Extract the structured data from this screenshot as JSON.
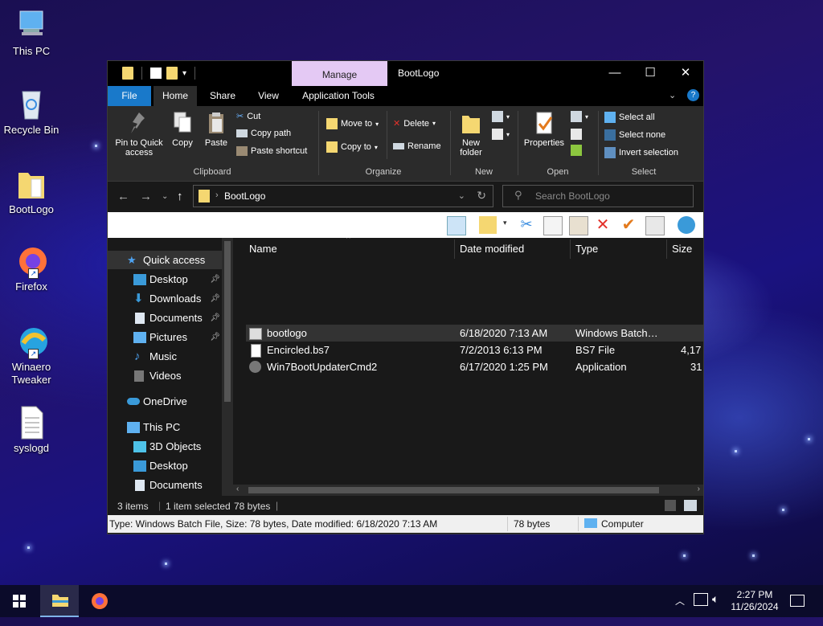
{
  "desktop": {
    "icons": [
      {
        "label": "This PC",
        "icon": "computer-icon"
      },
      {
        "label": "Recycle Bin",
        "icon": "recycle-bin-icon"
      },
      {
        "label": "BootLogo",
        "icon": "folder-icon"
      },
      {
        "label": "Firefox",
        "icon": "firefox-icon"
      },
      {
        "label": "Winaero\nTweaker",
        "icon": "winaero-tweaker-icon"
      },
      {
        "label": "syslogd",
        "icon": "text-file-icon"
      }
    ]
  },
  "window": {
    "title": "BootLogo",
    "context_tab": "Manage",
    "tabs": [
      "File",
      "Home",
      "Share",
      "View",
      "Application Tools"
    ],
    "ribbon": {
      "clipboard": {
        "label": "Clipboard",
        "pin": "Pin to Quick\naccess",
        "copy": "Copy",
        "paste": "Paste",
        "cut": "Cut",
        "copy_path": "Copy path",
        "paste_shortcut": "Paste shortcut"
      },
      "organize": {
        "label": "Organize",
        "move_to": "Move to",
        "copy_to": "Copy to",
        "delete": "Delete",
        "rename": "Rename"
      },
      "new": {
        "label": "New",
        "new_folder": "New\nfolder"
      },
      "open": {
        "label": "Open",
        "properties": "Properties"
      },
      "select": {
        "label": "Select",
        "select_all": "Select all",
        "select_none": "Select none",
        "invert": "Invert selection"
      }
    },
    "address": {
      "path": "BootLogo",
      "search_placeholder": "Search BootLogo"
    },
    "nav": {
      "items": [
        {
          "label": "Quick access",
          "icon": "star-icon",
          "pinned": false,
          "selected": true
        },
        {
          "label": "Desktop",
          "icon": "desktop-icon",
          "pinned": true
        },
        {
          "label": "Downloads",
          "icon": "download-icon",
          "pinned": true
        },
        {
          "label": "Documents",
          "icon": "documents-icon",
          "pinned": true
        },
        {
          "label": "Pictures",
          "icon": "pictures-icon",
          "pinned": true
        },
        {
          "label": "Music",
          "icon": "music-icon",
          "pinned": false
        },
        {
          "label": "Videos",
          "icon": "videos-icon",
          "pinned": false
        },
        {
          "label": "OneDrive",
          "icon": "onedrive-icon",
          "pinned": false
        },
        {
          "label": "This PC",
          "icon": "computer-icon",
          "pinned": false
        },
        {
          "label": "3D Objects",
          "icon": "cube-icon",
          "pinned": false
        },
        {
          "label": "Desktop",
          "icon": "desktop-icon",
          "pinned": false
        },
        {
          "label": "Documents",
          "icon": "documents-icon",
          "pinned": false
        }
      ]
    },
    "columns": {
      "name": "Name",
      "date": "Date modified",
      "type": "Type",
      "size": "Size"
    },
    "files": [
      {
        "name": "bootlogo",
        "date": "6/18/2020 7:13 AM",
        "type": "Windows Batch…",
        "size": "",
        "icon": "batch-file-icon",
        "selected": true
      },
      {
        "name": "Encircled.bs7",
        "date": "7/2/2013 6:13 PM",
        "type": "BS7 File",
        "size": "4,17",
        "icon": "file-icon",
        "selected": false
      },
      {
        "name": "Win7BootUpdaterCmd2",
        "date": "6/17/2020 1:25 PM",
        "type": "Application",
        "size": "31",
        "icon": "application-icon",
        "selected": false
      }
    ],
    "status": {
      "count": "3 items",
      "selected": "1 item selected",
      "size": "78 bytes"
    },
    "details": {
      "text": "Type: Windows Batch File, Size: 78 bytes, Date modified: 6/18/2020 7:13 AM",
      "size": "78 bytes",
      "location": "Computer"
    }
  },
  "taskbar": {
    "time": "2:27 PM",
    "date": "11/26/2024"
  },
  "colors": {
    "file_tab": "#1979ca",
    "manage_tab": "#e4c9f4",
    "folder": "#f5d771"
  }
}
